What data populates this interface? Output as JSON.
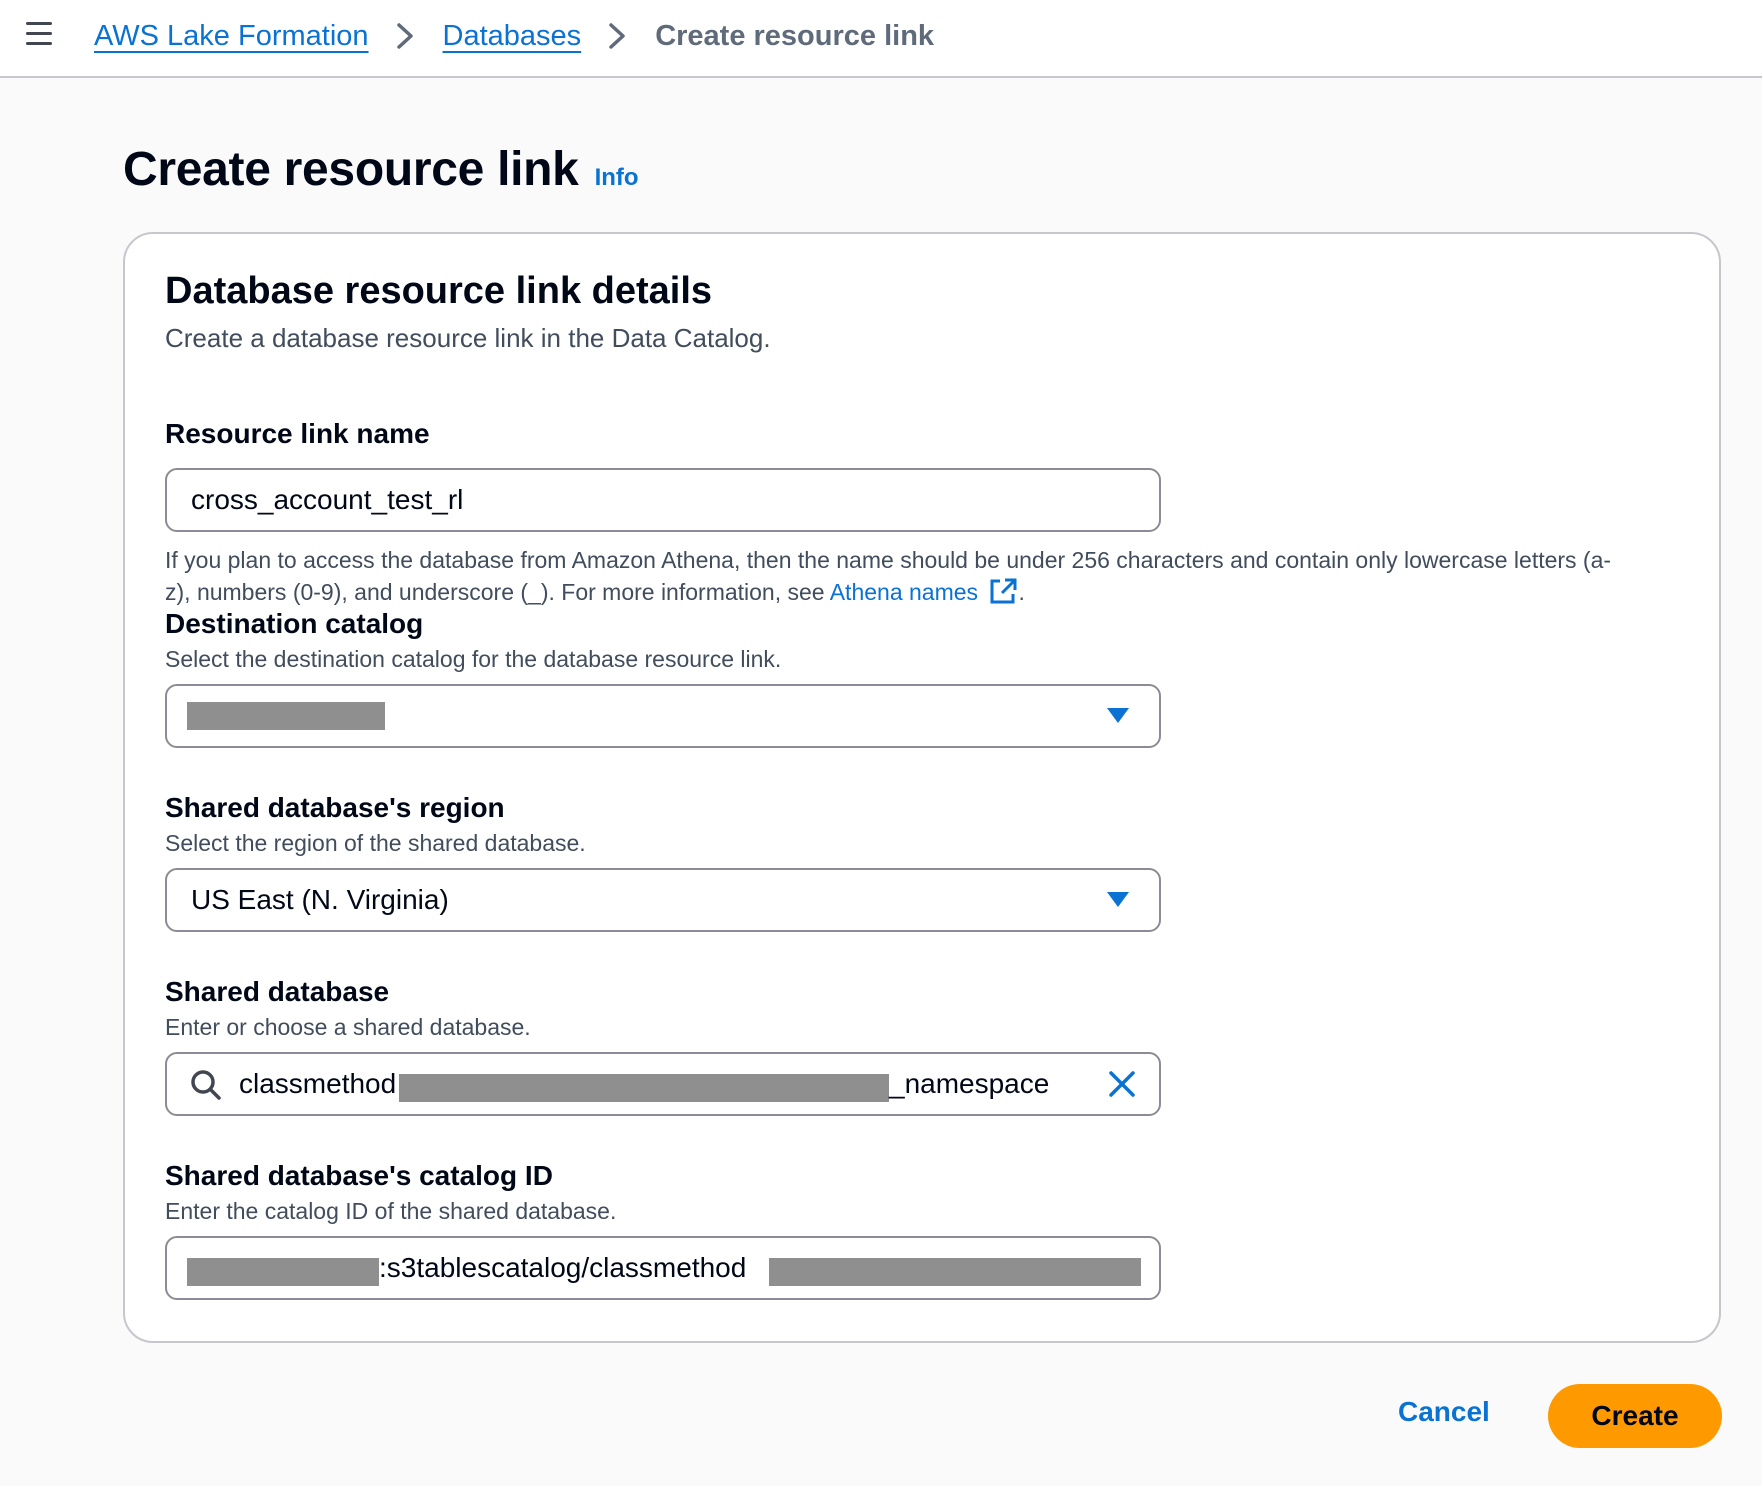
{
  "breadcrumb": {
    "items": [
      {
        "label": "AWS Lake Formation"
      },
      {
        "label": "Databases"
      }
    ],
    "current": "Create resource link"
  },
  "page": {
    "title": "Create resource link",
    "info_label": "Info"
  },
  "section": {
    "title": "Database resource link details",
    "description": "Create a database resource link in the Data Catalog."
  },
  "fields": {
    "resource_link_name": {
      "label": "Resource link name",
      "value": "cross_account_test_rl",
      "hint_text": "If you plan to access the database from Amazon Athena, then the name should be under 256 characters and contain only lowercase letters (a-z), numbers (0-9), and underscore (_). For more information, see",
      "hint_link": "Athena names",
      "hint_suffix": "."
    },
    "destination_catalog": {
      "label": "Destination catalog",
      "description": "Select the destination catalog for the database resource link."
    },
    "shared_db_region": {
      "label": "Shared database's region",
      "description": "Select the region of the shared database.",
      "value": "US East (N. Virginia)"
    },
    "shared_database": {
      "label": "Shared database",
      "description": "Enter or choose a shared database.",
      "value_prefix": "classmethod",
      "value_suffix": "_namespace"
    },
    "shared_db_catalog_id": {
      "label": "Shared database's catalog ID",
      "description": "Enter the catalog ID of the shared database.",
      "value_visible": ":s3tablescatalog/classmethod"
    }
  },
  "footer": {
    "cancel_label": "Cancel",
    "create_label": "Create"
  },
  "colors": {
    "accent": "#0972d3",
    "primary_button": "#ff9900",
    "redaction": "#8f8f8f"
  },
  "icons": {
    "menu": "hamburger-menu-icon",
    "separator": "chevron-right-icon",
    "dropdown": "caret-down-icon",
    "search": "search-icon",
    "clear": "close-icon",
    "external": "external-link-icon"
  }
}
